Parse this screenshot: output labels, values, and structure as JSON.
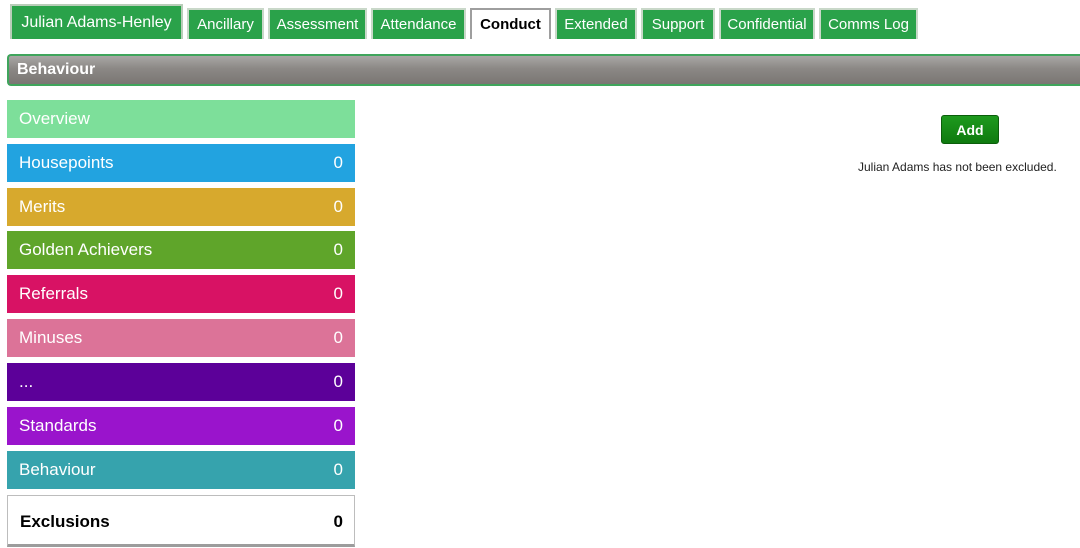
{
  "student_tab": {
    "label": "Julian Adams-Henley"
  },
  "tabs": [
    {
      "label": "Ancillary"
    },
    {
      "label": "Assessment"
    },
    {
      "label": "Attendance"
    },
    {
      "label": "Conduct"
    },
    {
      "label": "Extended"
    },
    {
      "label": "Support"
    },
    {
      "label": "Confidential"
    },
    {
      "label": "Comms Log"
    }
  ],
  "active_tab": "Conduct",
  "section": {
    "title": "Behaviour"
  },
  "sidebar": {
    "items": [
      {
        "label": "Overview",
        "count": "",
        "color": "#7ddf9a"
      },
      {
        "label": "Housepoints",
        "count": "0",
        "color": "#22a3e0"
      },
      {
        "label": "Merits",
        "count": "0",
        "color": "#d7a92d"
      },
      {
        "label": "Golden Achievers",
        "count": "0",
        "color": "#5fa52a"
      },
      {
        "label": "Referrals",
        "count": "0",
        "color": "#d81264"
      },
      {
        "label": "Minuses",
        "count": "0",
        "color": "#dc7398"
      },
      {
        "label": "...",
        "count": "0",
        "color": "#5c0099"
      },
      {
        "label": "Standards",
        "count": "0",
        "color": "#9a14cc"
      },
      {
        "label": "Behaviour",
        "count": "0",
        "color": "#36a3ad"
      },
      {
        "label": "Exclusions",
        "count": "0",
        "color": "#ffffff"
      }
    ]
  },
  "content": {
    "add_label": "Add",
    "message": "Julian Adams has not been excluded."
  },
  "colors": {
    "tab_green": "#2aa24a",
    "add_button": "#138a13"
  }
}
